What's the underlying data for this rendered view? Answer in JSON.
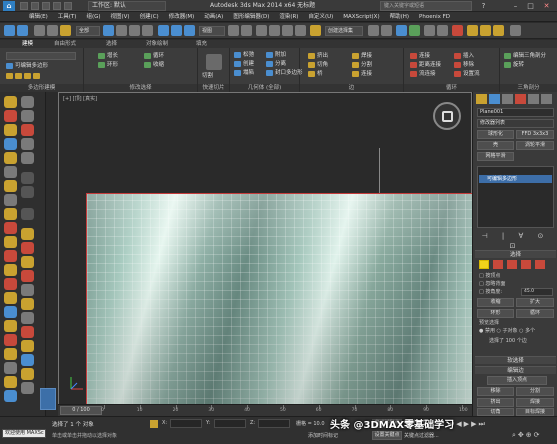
{
  "app": {
    "title": "Autodesk 3ds Max  2014 x64      无标题",
    "workspace": "工作区: 默认",
    "search_placeholder": "键入关键字或短语"
  },
  "menu": [
    "编辑(E)",
    "工具(T)",
    "组(G)",
    "视图(V)",
    "创建(C)",
    "修改器(M)",
    "动画(A)",
    "图形编辑器(D)",
    "渲染(R)",
    "自定义(U)",
    "MAXScript(X)",
    "帮助(H)",
    "Phoenix FD"
  ],
  "toolbar": {
    "selection_filter": "全部",
    "view_dropdown": "视图",
    "named_selection": "创建选择集"
  },
  "ribbon": {
    "tabs": [
      "建模",
      "自由形式",
      "选择",
      "对象绘制",
      "填充"
    ],
    "groups": {
      "poly": {
        "label": "多边形建模",
        "items": [
          "可编辑多边形"
        ]
      },
      "modify_sel": {
        "label": "修改选择",
        "items": [
          "增长",
          "环形",
          "循环",
          "收缩"
        ]
      },
      "edit": {
        "label": "编辑",
        "items": [
          "快速切片",
          "切割",
          "QSlice"
        ]
      },
      "geometry": {
        "label": "几何体 (全部)",
        "items": [
          "松弛",
          "创建",
          "塌陷",
          "附加",
          "分离",
          "封口多边形"
        ]
      },
      "edges": {
        "label": "边",
        "items": [
          "挤出",
          "切角",
          "分割",
          "桥",
          "焊接",
          "连接"
        ]
      },
      "loops": {
        "label": "循环",
        "items": [
          "连接",
          "插入",
          "距离连接",
          "移除",
          "流连接",
          "设置流"
        ]
      },
      "tris": {
        "label": "三角剖分",
        "items": [
          "编辑三角剖分",
          "旋转"
        ]
      }
    }
  },
  "viewport": {
    "label": "[+] [顶] [真实]"
  },
  "command_panel": {
    "object_name": "Plane001",
    "modifier_list": "修改器列表",
    "buttons": [
      "球形化",
      "FFD 3x3x3",
      "壳",
      "涡轮平滑",
      "网格平滑"
    ],
    "stack_item": "可编辑多边形",
    "selection": {
      "header": "选择",
      "by_vertex": "按顶点",
      "ignore_backface": "忽略背面",
      "angle_label": "按角度:",
      "angle_value": "45.0",
      "shrink": "收缩",
      "grow": "扩大",
      "ring": "环形",
      "loop": "循环",
      "preview_label": "预览选择",
      "preview_off": "禁用",
      "preview_sub": "子对象",
      "preview_multi": "多个",
      "count_text": "选择了 100 个边"
    },
    "soft_selection": "软选择",
    "edit_edges": {
      "header": "编辑边",
      "insert_vertex": "插入顶点",
      "remove": "移除",
      "split": "分割",
      "extrude": "挤出",
      "weld": "焊接",
      "chamfer": "切角",
      "target_weld": "目标焊接"
    }
  },
  "timeline": {
    "position": "0 / 100",
    "ticks": [
      "0",
      "10",
      "20",
      "30",
      "40",
      "50",
      "60",
      "70",
      "80",
      "90",
      "100"
    ]
  },
  "status": {
    "maxscript": "欢迎使用 MAXSc",
    "selected": "选择了 1 个 对象",
    "hint": "单击或单击并拖动以选择对象",
    "x_label": "X:",
    "y_label": "Y:",
    "z_label": "Z:",
    "grid_label": "栅格 = 10.0",
    "add_time_tag": "添加时间标记",
    "auto_key": "自动关键点",
    "selected_obj": "选定对象",
    "set_key": "设置关键点",
    "key_filters": "关键点过滤器..."
  },
  "watermark": "头条 @3DMAX零基础学习",
  "colors": {
    "accent": "#4a8ed0",
    "selection_red": "#c43b3b",
    "yellow_active": "#f2d21b"
  }
}
